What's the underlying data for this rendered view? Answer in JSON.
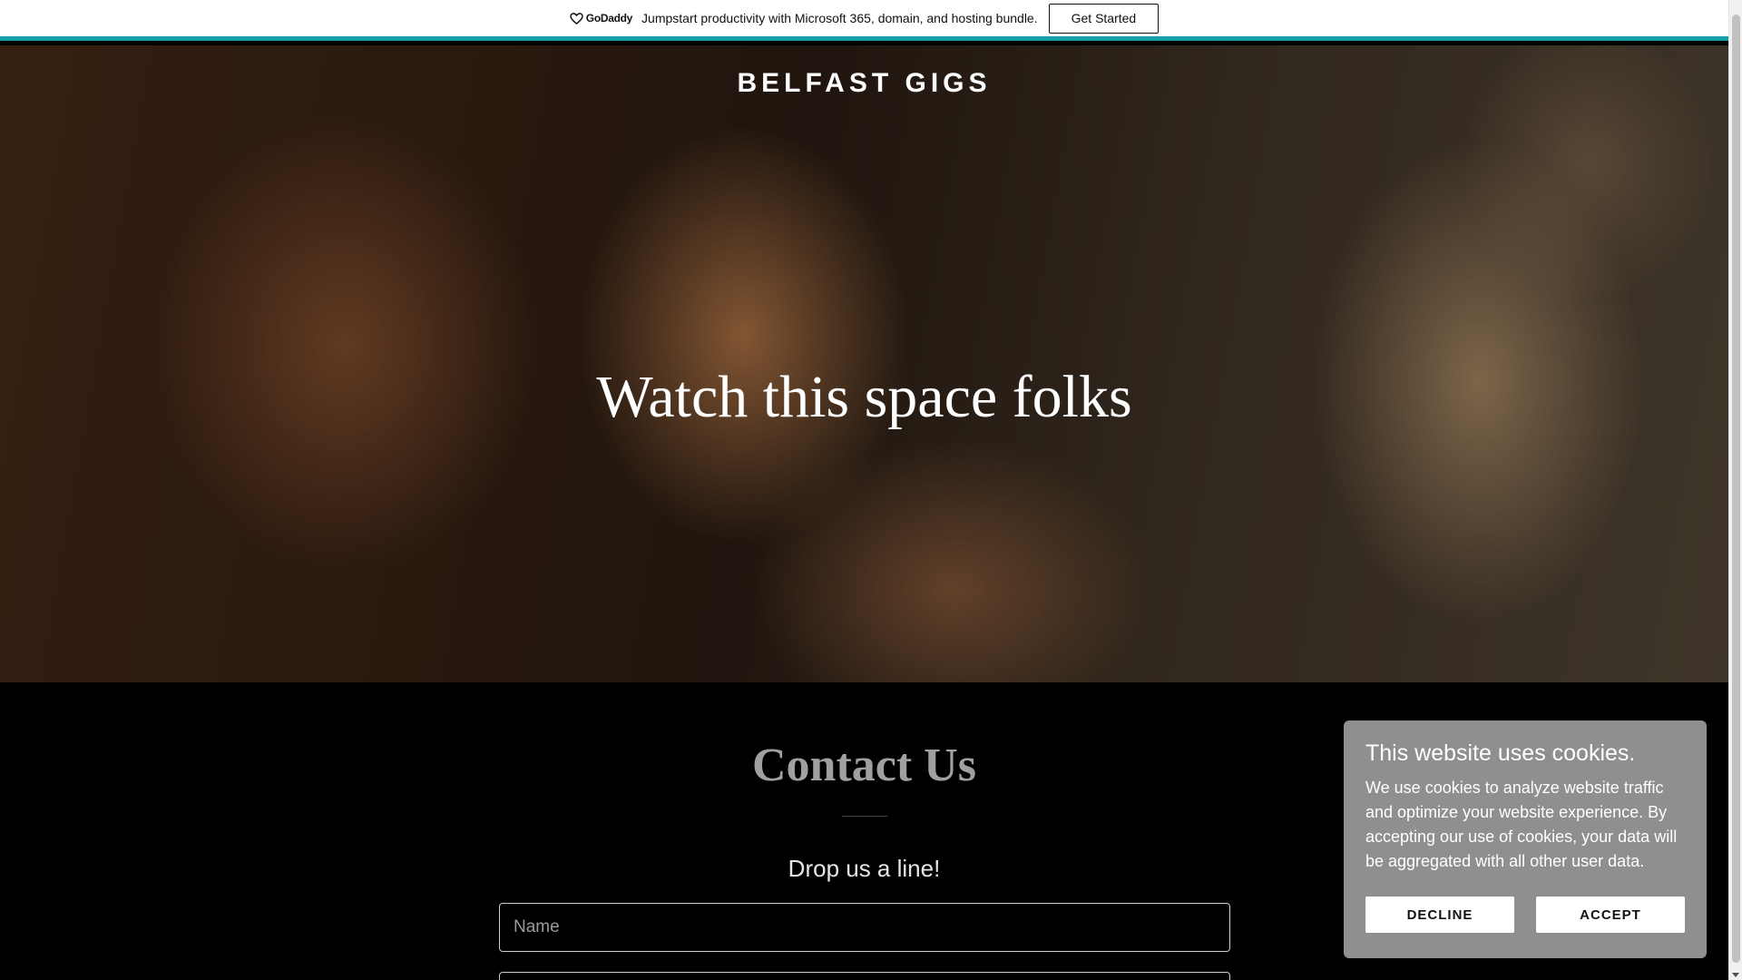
{
  "promo": {
    "logo_text": "GoDaddy",
    "message": "Jumpstart productivity with Microsoft 365, domain, and hosting bundle.",
    "cta_label": "Get Started",
    "accent_color": "#1a9ea8"
  },
  "hero": {
    "site_title": "BELFAST GIGS",
    "heading": "Watch this space folks"
  },
  "contact": {
    "title": "Contact Us",
    "subtitle": "Drop us a line!",
    "name_placeholder": "Name"
  },
  "cookie": {
    "title": "This website uses cookies.",
    "text": "We use cookies to analyze website traffic and optimize your website experience. By accepting our use of cookies, your data will be aggregated with all other user data.",
    "decline_label": "DECLINE",
    "accept_label": "ACCEPT"
  }
}
